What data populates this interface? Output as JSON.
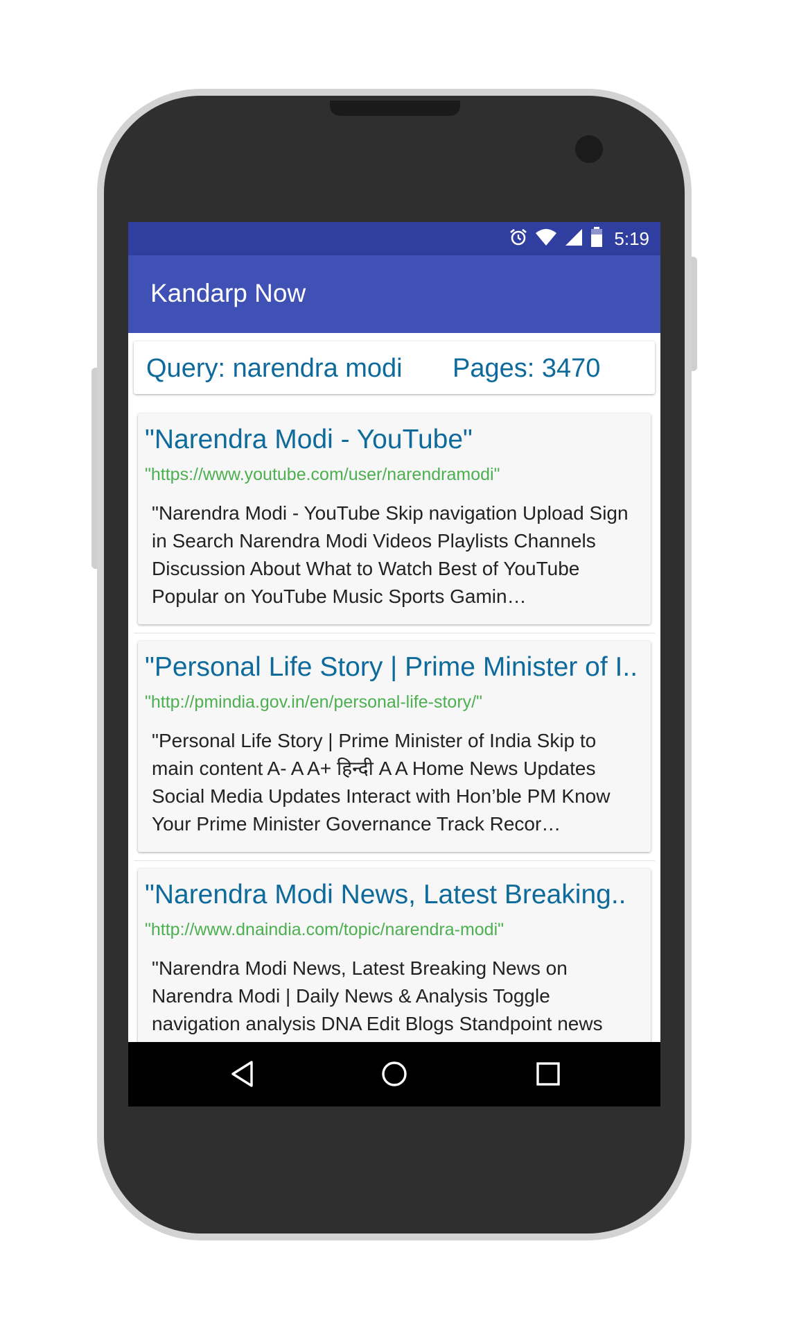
{
  "status_bar": {
    "time": "5:19",
    "icons": [
      "alarm-icon",
      "wifi-icon",
      "signal-icon",
      "battery-icon"
    ]
  },
  "app_bar": {
    "title": "Kandarp Now"
  },
  "query_card": {
    "query_label": "Query: narendra modi",
    "pages_label": "Pages: 3470"
  },
  "results": [
    {
      "title": "\"Narendra Modi - YouTube\"",
      "url": "\"https://www.youtube.com/user/narendramodi\"",
      "snippet": "\"Narendra Modi - YouTube Skip navigation Upload Sign in Search Narendra Modi Videos Playlists Channels Discussion About What to Watch Best of YouTube Popular on YouTube Music Sports Gamin…"
    },
    {
      "title": "\"Personal Life Story | Prime Minister of I..",
      "url": "\"http://pmindia.gov.in/en/personal-life-story/\"",
      "snippet": "\"Personal Life Story | Prime Minister of India Skip to main content A- A A+ हिन्दी A A Home News Updates Social Media Updates Interact with Hon’ble PM Know Your Prime Minister Governance Track Recor…"
    },
    {
      "title": "\"Narendra Modi News, Latest Breaking..",
      "url": "\"http://www.dnaindia.com/topic/narendra-modi\"",
      "snippet": "\"Narendra Modi News, Latest Breaking News on Narendra Modi | Daily News & Analysis Toggle navigation analysis DNA Edit Blogs Standpoint news"
    }
  ],
  "nav_bar": {
    "buttons": [
      "back-icon",
      "home-icon",
      "recents-icon"
    ]
  },
  "colors": {
    "status_bar": "#303f9f",
    "app_bar": "#3f51b5",
    "title_text": "#0d6a9b",
    "url_text": "#4caf50"
  }
}
